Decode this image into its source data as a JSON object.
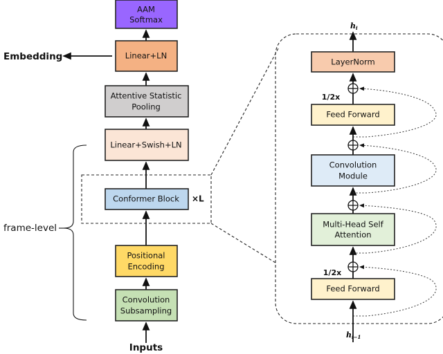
{
  "left": {
    "aam_softmax": {
      "line1": "AAM",
      "line2": "Softmax",
      "color": "#9966ff"
    },
    "linear_ln": {
      "label": "Linear+LN",
      "color": "#f4b183"
    },
    "pooling": {
      "line1": "Attentive Statistic",
      "line2": "Pooling",
      "color": "#d0cece"
    },
    "linear_swish_ln": {
      "label": "Linear+Swish+LN",
      "color": "#fbe5d6"
    },
    "conformer_block": {
      "label": "Conformer Block",
      "repeat": "×L",
      "color": "#bdd7ee"
    },
    "positional_encoding": {
      "line1": "Positional",
      "line2": "Encoding",
      "color": "#ffd966"
    },
    "conv_subsampling": {
      "line1": "Convolution",
      "line2": "Subsampling",
      "color": "#c5e0b4"
    },
    "inputs": "Inputs",
    "embedding": "Embedding",
    "frame_level": "frame-level"
  },
  "right": {
    "output_label": "h",
    "output_sub": "i",
    "input_label": "h",
    "input_sub": "i−1",
    "layernorm": {
      "label": "LayerNorm",
      "color": "#f8cbad"
    },
    "ff_top": {
      "label": "Feed Forward",
      "scale": "1/2x",
      "color": "#fff2cc"
    },
    "conv_module": {
      "line1": "Convolution",
      "line2": "Module",
      "color": "#deebf7"
    },
    "mhsa": {
      "line1": "Multi-Head Self",
      "line2": "Attention",
      "color": "#e2f0d9"
    },
    "ff_bottom": {
      "label": "Feed Forward",
      "scale": "1/2x",
      "color": "#fff2cc"
    }
  }
}
